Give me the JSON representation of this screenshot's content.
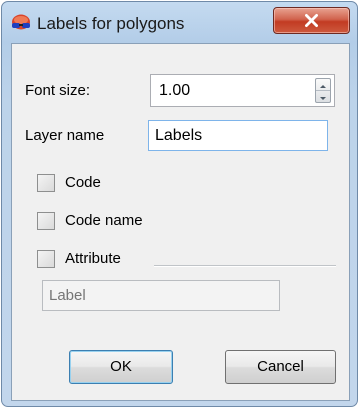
{
  "window": {
    "title": "Labels for polygons",
    "close_icon": "close-x-icon",
    "app_icon": "3d-glasses-icon"
  },
  "form": {
    "font_size_label": "Font size:",
    "font_size_value": "1.00",
    "layer_name_label": "Layer name",
    "layer_name_value": "Labels",
    "checkboxes": [
      {
        "label": "Code",
        "checked": false
      },
      {
        "label": "Code name",
        "checked": false
      },
      {
        "label": "Attribute",
        "checked": false
      }
    ],
    "attribute_placeholder": "Label"
  },
  "buttons": {
    "ok": "OK",
    "cancel": "Cancel"
  },
  "colors": {
    "close_button": "#c94a33",
    "accent_focus": "#3c7fb1"
  }
}
